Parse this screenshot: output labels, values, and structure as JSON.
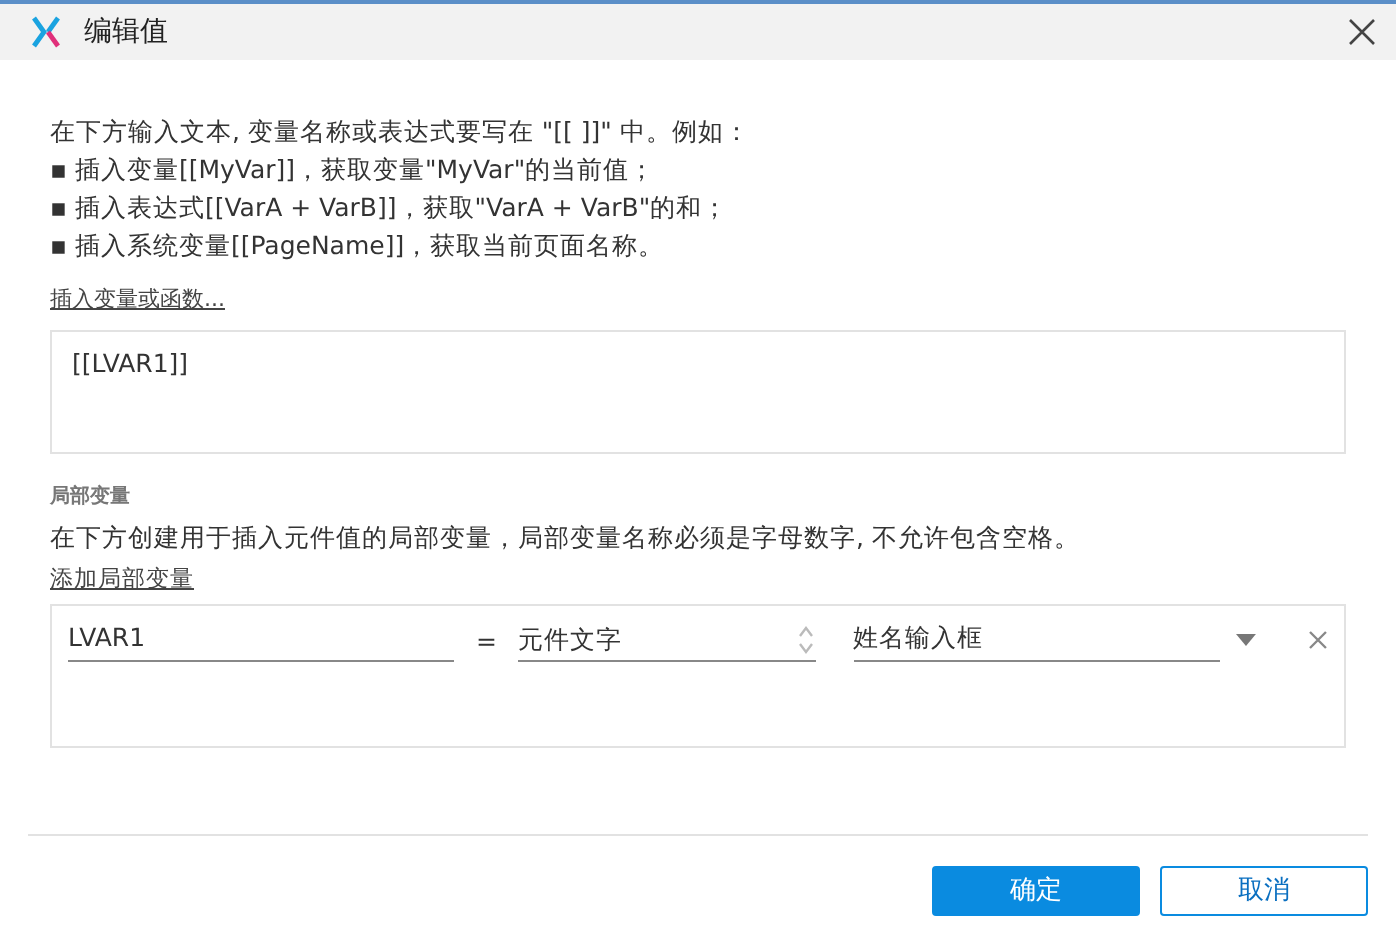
{
  "window": {
    "title": "编辑值"
  },
  "intro": [
    "在下方输入文本, 变量名称或表达式要写在 \"[[ ]]\" 中。例如：",
    "▪ 插入变量[[MyVar]]，获取变量\"MyVar\"的当前值；",
    "▪ 插入表达式[[VarA + VarB]]，获取\"VarA + VarB\"的和；",
    "▪ 插入系统变量[[PageName]]，获取当前页面名称。"
  ],
  "insert_link": "插入变量或函数...",
  "expression": {
    "value": "[[LVAR1]]"
  },
  "local_variables": {
    "label": "局部变量",
    "description": "在下方创建用于插入元件值的局部变量，局部变量名称必须是字母数字, 不允许包含空格。",
    "add_link": "添加局部变量",
    "rows": [
      {
        "name": "LVAR1",
        "operator": "=",
        "source": "元件文字",
        "target": "姓名输入框"
      }
    ]
  },
  "buttons": [
    {
      "label": "确定",
      "kind": "primary"
    },
    {
      "label": "取消",
      "kind": "secondary"
    }
  ]
}
